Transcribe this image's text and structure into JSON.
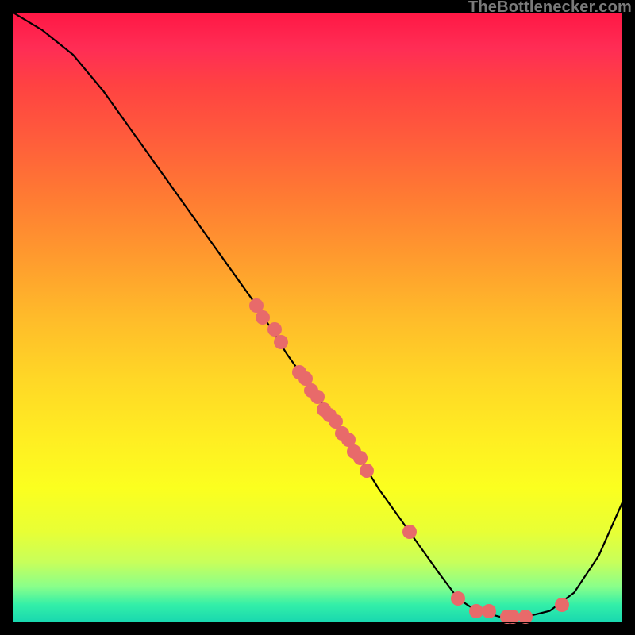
{
  "watermark": "TheBottlenecker.com",
  "chart_data": {
    "type": "line",
    "title": "",
    "xlabel": "",
    "ylabel": "",
    "xlim": [
      0,
      100
    ],
    "ylim": [
      0,
      100
    ],
    "grid": false,
    "series": [
      {
        "name": "bottleneck-curve",
        "x": [
          0,
          5,
          10,
          15,
          20,
          25,
          30,
          35,
          40,
          45,
          50,
          55,
          60,
          65,
          70,
          73,
          76,
          80,
          84,
          88,
          92,
          96,
          100
        ],
        "y": [
          100,
          97,
          93,
          87,
          80,
          73,
          66,
          59,
          52,
          44,
          37,
          30,
          22,
          15,
          8,
          4,
          2,
          1,
          1,
          2,
          5,
          11,
          20
        ]
      }
    ],
    "markers": [
      {
        "x": 40,
        "y": 52
      },
      {
        "x": 41,
        "y": 50
      },
      {
        "x": 43,
        "y": 48
      },
      {
        "x": 44,
        "y": 46
      },
      {
        "x": 47,
        "y": 41
      },
      {
        "x": 48,
        "y": 40
      },
      {
        "x": 49,
        "y": 38
      },
      {
        "x": 50,
        "y": 37
      },
      {
        "x": 51,
        "y": 35
      },
      {
        "x": 52,
        "y": 34
      },
      {
        "x": 53,
        "y": 33
      },
      {
        "x": 54,
        "y": 31
      },
      {
        "x": 55,
        "y": 30
      },
      {
        "x": 56,
        "y": 28
      },
      {
        "x": 57,
        "y": 27
      },
      {
        "x": 58,
        "y": 25
      },
      {
        "x": 65,
        "y": 15
      },
      {
        "x": 73,
        "y": 4
      },
      {
        "x": 76,
        "y": 2
      },
      {
        "x": 78,
        "y": 2
      },
      {
        "x": 81,
        "y": 1
      },
      {
        "x": 82,
        "y": 1
      },
      {
        "x": 84,
        "y": 1
      },
      {
        "x": 90,
        "y": 3
      }
    ],
    "colors": {
      "curve": "#000000",
      "marker": "#e86a6a"
    }
  }
}
